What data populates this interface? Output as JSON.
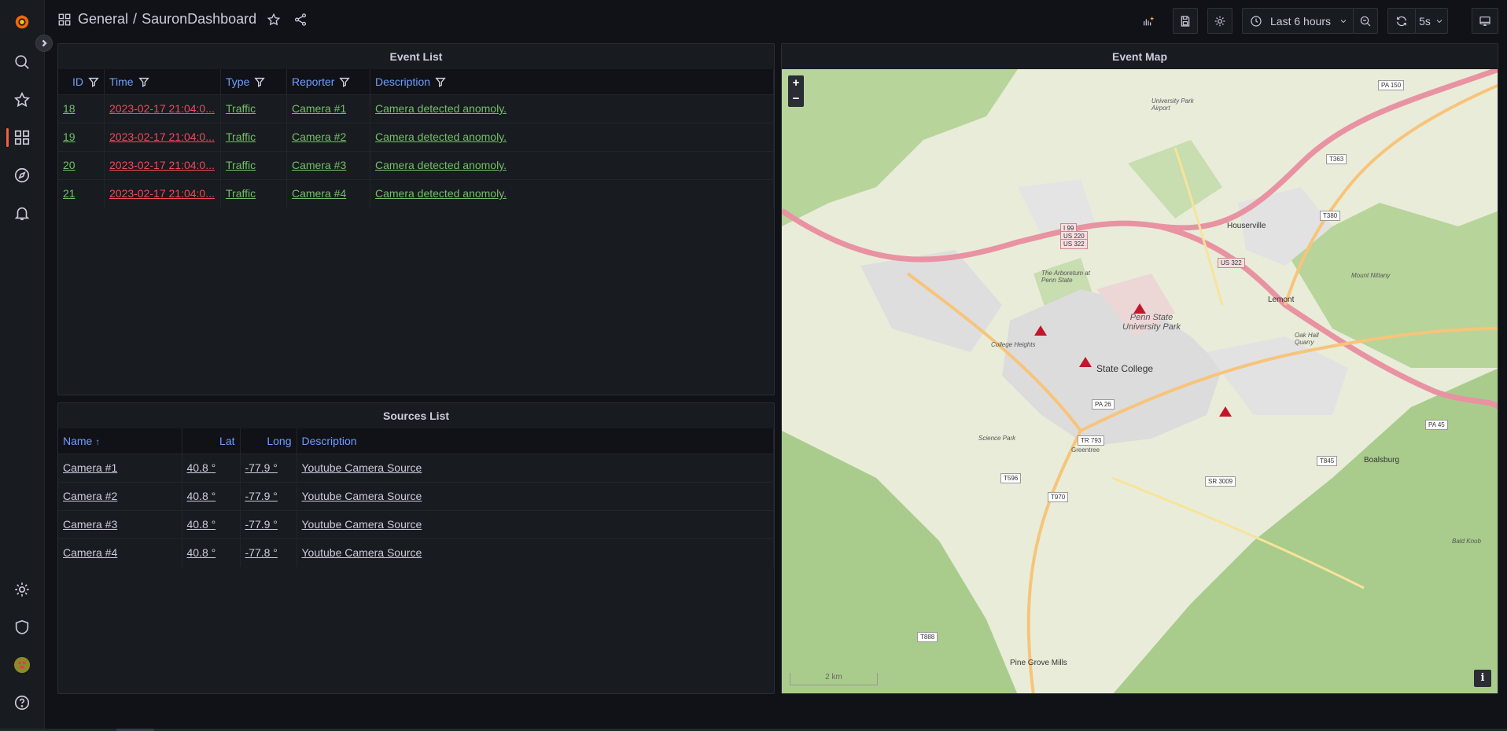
{
  "breadcrumb": {
    "folder": "General",
    "separator": "/",
    "dashboard": "SauronDashboard"
  },
  "toolbar": {
    "time_range": "Last 6 hours",
    "refresh_interval": "5s"
  },
  "event_list": {
    "title": "Event List",
    "columns": [
      "ID",
      "Time",
      "Type",
      "Reporter",
      "Description"
    ],
    "rows": [
      {
        "id": "18",
        "time": "2023-02-17 21:04:0...",
        "type": "Traffic",
        "reporter": "Camera #1",
        "description": "Camera detected anomoly."
      },
      {
        "id": "19",
        "time": "2023-02-17 21:04:0...",
        "type": "Traffic",
        "reporter": "Camera #2",
        "description": "Camera detected anomoly."
      },
      {
        "id": "20",
        "time": "2023-02-17 21:04:0...",
        "type": "Traffic",
        "reporter": "Camera #3",
        "description": "Camera detected anomoly."
      },
      {
        "id": "21",
        "time": "2023-02-17 21:04:0...",
        "type": "Traffic",
        "reporter": "Camera #4",
        "description": "Camera detected anomoly."
      }
    ]
  },
  "sources_list": {
    "title": "Sources List",
    "columns": [
      "Name",
      "Lat",
      "Long",
      "Description"
    ],
    "sort_indicator": "↑",
    "rows": [
      {
        "name": "Camera #1",
        "lat": "40.8 °",
        "long": "-77.9 °",
        "description": "Youtube Camera Source"
      },
      {
        "name": "Camera #2",
        "lat": "40.8 °",
        "long": "-77.9 °",
        "description": "Youtube Camera Source"
      },
      {
        "name": "Camera #3",
        "lat": "40.8 °",
        "long": "-77.9 °",
        "description": "Youtube Camera Source"
      },
      {
        "name": "Camera #4",
        "lat": "40.8 °",
        "long": "-77.8 °",
        "description": "Youtube Camera Source"
      }
    ]
  },
  "event_map": {
    "title": "Event Map",
    "zoom_in": "+",
    "zoom_out": "−",
    "info": "i",
    "scale_text": "2 km",
    "place_labels": [
      "State College",
      "Penn State University Park",
      "Lemont",
      "Houserville",
      "Boalsburg",
      "Pine Grove Mills",
      "College Heights",
      "Science Park",
      "The Arboretum at Penn State",
      "Greentree",
      "University Park Airport",
      "Oak Hall Quarry",
      "Mount Nittany",
      "Bald Knob"
    ],
    "road_labels": [
      "I 99",
      "US 220",
      "US 322",
      "PA 26",
      "PA 45",
      "PA 150",
      "T363",
      "T380",
      "T845",
      "TR 793",
      "T596",
      "T970",
      "T888",
      "SR 3009",
      "US 322"
    ],
    "marker_color": "#c4162a"
  },
  "colors": {
    "accent": "#f55f3e",
    "link_green": "#73bf69",
    "link_red": "#f2495c",
    "header_blue": "#6e9fff"
  }
}
